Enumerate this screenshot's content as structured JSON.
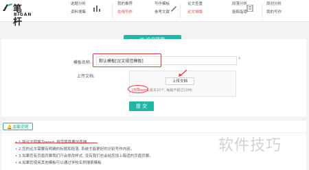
{
  "brand": {
    "name_cn": "笔杆",
    "name_en": "BIGAN"
  },
  "nav": {
    "group1": {
      "item_a": "选题分析",
      "item_b": "资料搜集"
    },
    "group2": {
      "item_a": "我的推荐",
      "item_b": "在线写作"
    },
    "group3": {
      "item_a": "写作模板",
      "item_b": "参考文献"
    },
    "group4": {
      "item_a": "论文查重",
      "item_b": "论文排版"
    },
    "group5": {
      "item_a": "段落分析",
      "item_b": "投稿指南"
    },
    "group6": {
      "item_a": "原创分析",
      "item_b": "我的写作"
    }
  },
  "form": {
    "title": "论文排版",
    "template_label": "模板名称:",
    "template_value": "默认模板[论文规范模板]",
    "required_mark": "*",
    "upload_label": "上传文档:",
    "upload_button": "上传文档",
    "hint_prefix": "(仅限word,",
    "hint_rest": "最多10个, 每篇不超过15M)",
    "submit": "提 交"
  },
  "tips": {
    "tab": "温馨提醒",
    "items": [
      "1.将论文转换为word, 规范篇章要加查搜。",
      "2.您的论文需要有明确的标题和段落, 系统才能更好的识别写作内容。",
      "3.如果您有页眉页脚我们只会修改样式, 没有我们也会给您加上稿适的页眉页脚。",
      "4.如果您使用其他模板可以通过学校名称搜索模板"
    ]
  },
  "watermark": "软件技巧",
  "colors": {
    "accent": "#20b8a5",
    "highlight": "#e23b3b",
    "active_nav": "#e64545"
  }
}
